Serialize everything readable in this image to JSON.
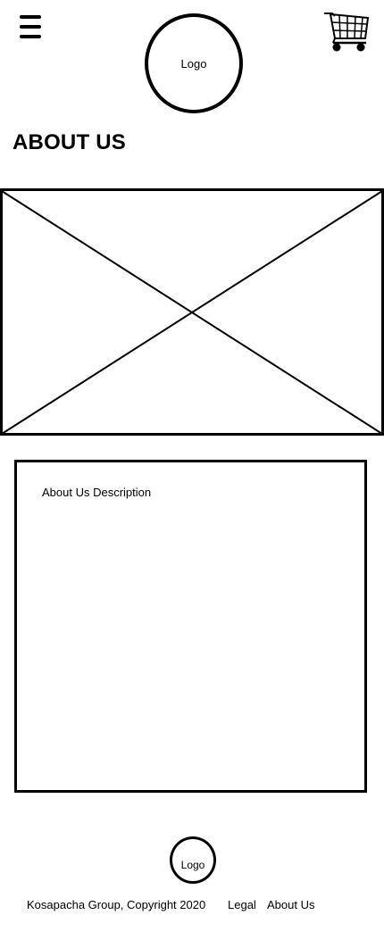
{
  "header": {
    "menu_icon": "hamburger-menu-icon",
    "logo_text": "Logo",
    "cart_icon": "shopping-cart-icon"
  },
  "page": {
    "title": "ABOUT US"
  },
  "hero_image": {
    "placeholder_icon": "image-placeholder-icon"
  },
  "description": {
    "text": "About Us Description"
  },
  "footer": {
    "logo_text": "Logo",
    "copyright": "Kosapacha Group, Copyright 2020",
    "links": [
      {
        "label": "Legal"
      },
      {
        "label": "About Us"
      }
    ]
  }
}
